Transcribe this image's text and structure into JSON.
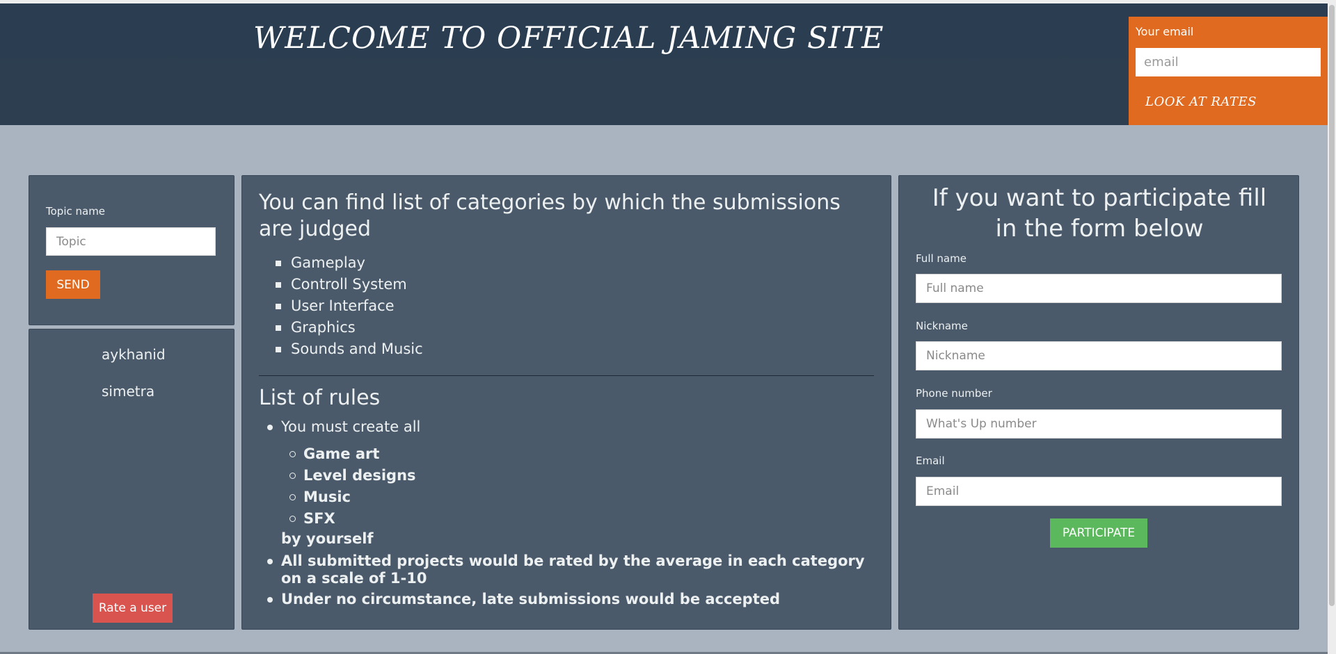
{
  "header": {
    "title": "WELCOME TO OFFICIAL JAMING SITE",
    "email_label": "Your email",
    "email_placeholder": "email",
    "rates_button": "LOOK AT RATES"
  },
  "topic": {
    "label": "Topic name",
    "placeholder": "Topic",
    "send_button": "SEND"
  },
  "users": {
    "items": [
      "aykhanid",
      "simetra"
    ],
    "rate_button": "Rate a user"
  },
  "categories": {
    "heading": "You can find list of categories by which the submissions are judged",
    "items": [
      "Gameplay",
      "Controll System",
      "User Interface",
      "Graphics",
      "Sounds and Music"
    ]
  },
  "rules": {
    "heading": "List of rules",
    "rule1_intro": "You must create all",
    "rule1_items": [
      "Game art",
      "Level designs",
      "Music",
      "SFX"
    ],
    "rule1_outro": "by yourself",
    "rule2": "All submitted projects would be rated by the average in each category on a scale of 1-10",
    "rule3": "Under no circumstance, late submissions would be accepted"
  },
  "form": {
    "heading": "If you want to participate fill in the form below",
    "fields": [
      {
        "label": "Full name",
        "placeholder": "Full name"
      },
      {
        "label": "Nickname",
        "placeholder": "Nickname"
      },
      {
        "label": "Phone number",
        "placeholder": "What's Up number"
      },
      {
        "label": "Email",
        "placeholder": "Email"
      }
    ],
    "submit_button": "PARTICIPATE"
  },
  "colors": {
    "header_bg": "#2c3e50",
    "accent_orange": "#e06a1f",
    "panel_bg": "#4b5a6a",
    "page_bg": "#a9b4c0",
    "success_green": "#5cb85c",
    "danger_red": "#d9534f"
  }
}
